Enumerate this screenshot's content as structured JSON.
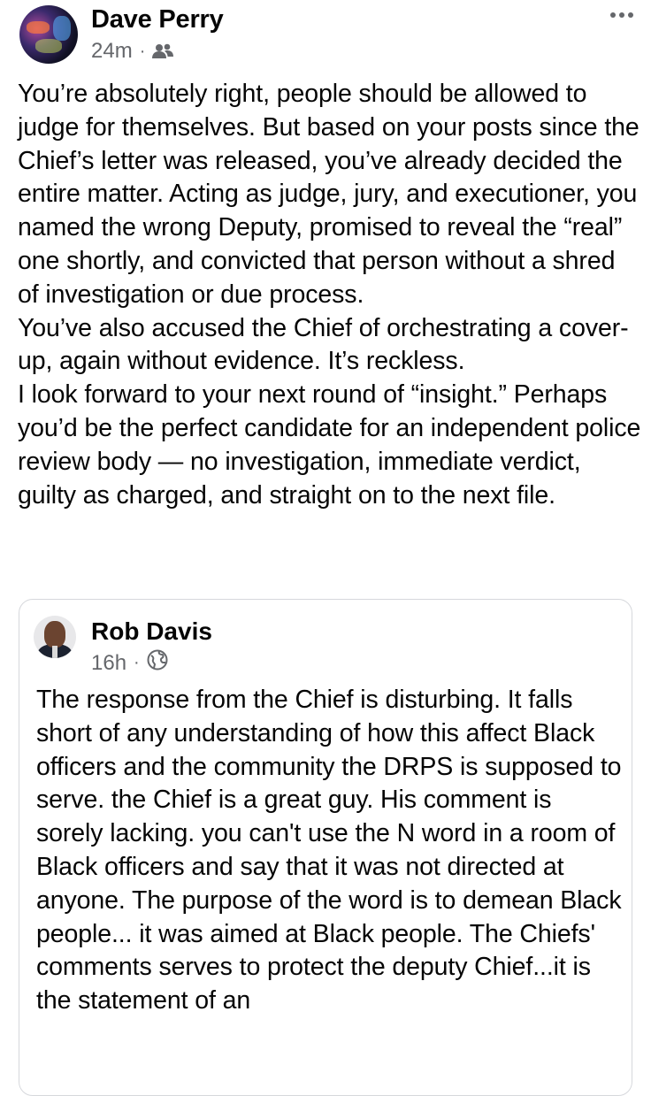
{
  "post": {
    "author": "Dave Perry",
    "timestamp": "24m",
    "separator": "·",
    "audience_icon": "friends-icon",
    "body": "You’re absolutely right, people should be allowed to judge for themselves. But based on your posts since the Chief’s letter was released, you’ve already decided the entire matter. Acting as judge, jury, and executioner, you named the wrong Deputy, promised to reveal the “real” one shortly, and convicted that person without a shred of investigation or due process.\nYou’ve also accused the Chief of orchestrating a cover-up, again without evidence. It’s reckless.\nI look forward to your next round of “insight.” Perhaps you’d be the perfect candidate for an independent police review body — no investigation, immediate verdict, guilty as charged, and straight on to the next file."
  },
  "shared_post": {
    "author": "Rob Davis",
    "timestamp": "16h",
    "separator": "·",
    "audience_icon": "globe-icon",
    "body": "The response from the Chief is disturbing. It falls short of any understanding of how this affect Black officers and the community the DRPS is supposed to serve.  the Chief is a great guy. His comment is sorely lacking. you can't use the N word in a room of Black officers and say that it was not directed at anyone. The purpose of the word is to demean Black people... it was aimed at Black people. The Chiefs' comments serves to protect the deputy Chief...it is the statement of an"
  },
  "colors": {
    "text": "#050505",
    "secondary_text": "#65676b",
    "card_border": "#d6d8dc"
  }
}
